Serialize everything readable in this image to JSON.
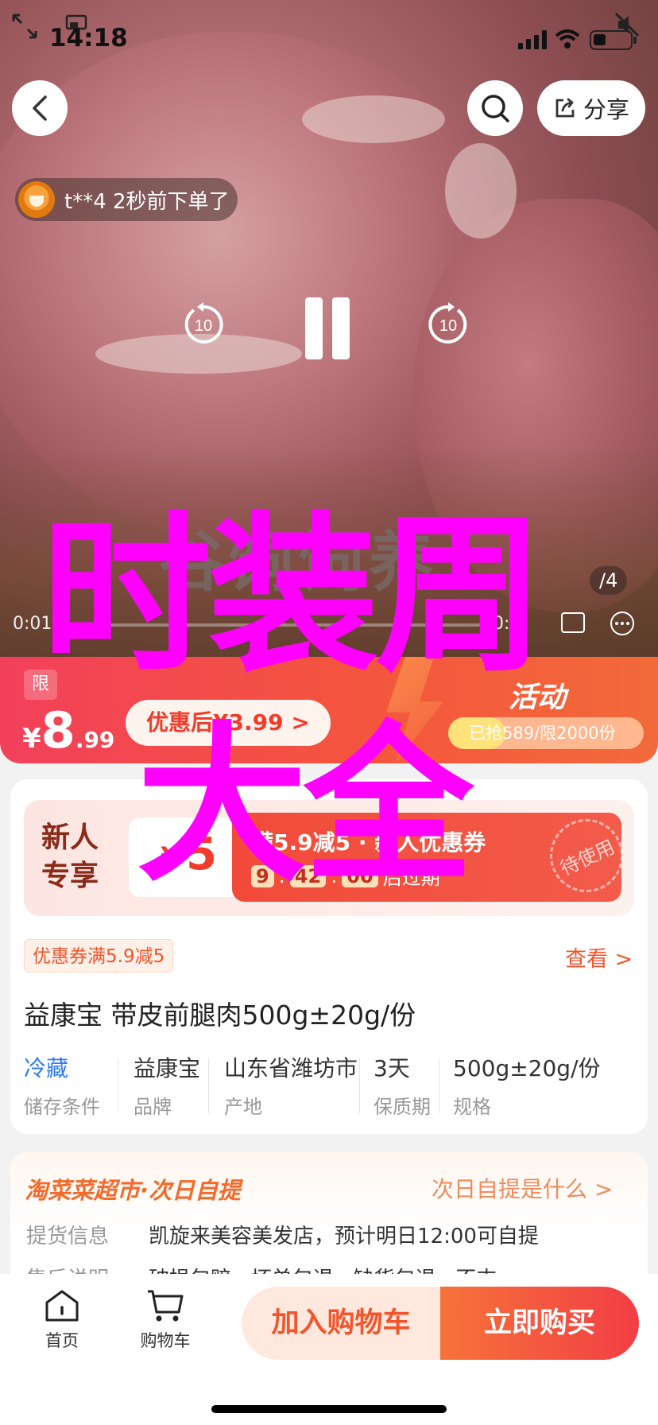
{
  "status_bar": {
    "time": "14:18",
    "battery_level": 0.35
  },
  "header": {
    "share_label": "分享"
  },
  "order_toast": {
    "text": "t**4 2秒前下单了"
  },
  "video": {
    "watermark": "谷饲饲养",
    "current_time": "0:01",
    "total_time": "0:1",
    "pager": "/4",
    "rewind_label": "10",
    "forward_label": "10"
  },
  "price_band": {
    "limit_tag": "限",
    "currency": "¥",
    "price_int": "8",
    "price_dec": ".99",
    "coupon_price": "优惠后¥3.99 >",
    "title": "活动",
    "sold_text": "已抢589/限2000份",
    "sold_fraction": 0.2945
  },
  "newbie": {
    "label": "新人专享",
    "currency": "¥",
    "amount": "5",
    "coupon_title": "满5.9减5 · 新人优惠券",
    "countdown": [
      "9",
      "42",
      "00"
    ],
    "countdown_suffix": "后过期",
    "stamp": "待使用"
  },
  "coupon_chip": "优惠券满5.9减5",
  "view_link": "查看 >",
  "product": {
    "title": "益康宝 带皮前腿肉500g±20g/份",
    "attributes": [
      {
        "value": "冷藏",
        "key": "储存条件"
      },
      {
        "value": "益康宝",
        "key": "品牌"
      },
      {
        "value": "山东省潍坊市",
        "key": "产地"
      },
      {
        "value": "3天",
        "key": "保质期"
      },
      {
        "value": "500g±20g/份",
        "key": "规格"
      }
    ]
  },
  "pickup": {
    "brand": "淘菜菜超市·次日自提",
    "what_link": "次日自提是什么 >",
    "rows": [
      {
        "key": "提货信息",
        "value": "凯旋来美容美发店，预计明日12:00可自提"
      },
      {
        "key": "售后说明",
        "value": "破损包赔 · 坏单包退 · 缺货包退 · 不支..."
      }
    ]
  },
  "bottom_bar": {
    "tabs": [
      {
        "label": "首页"
      },
      {
        "label": "购物车"
      }
    ],
    "add_to_cart": "加入购物车",
    "buy_now": "立即购买"
  },
  "overlay": {
    "line1": "时装周",
    "line2": "大全"
  },
  "colors": {
    "accent": "#f2552c",
    "overlay": "#ff00ff",
    "link_blue": "#2f7bf2"
  }
}
